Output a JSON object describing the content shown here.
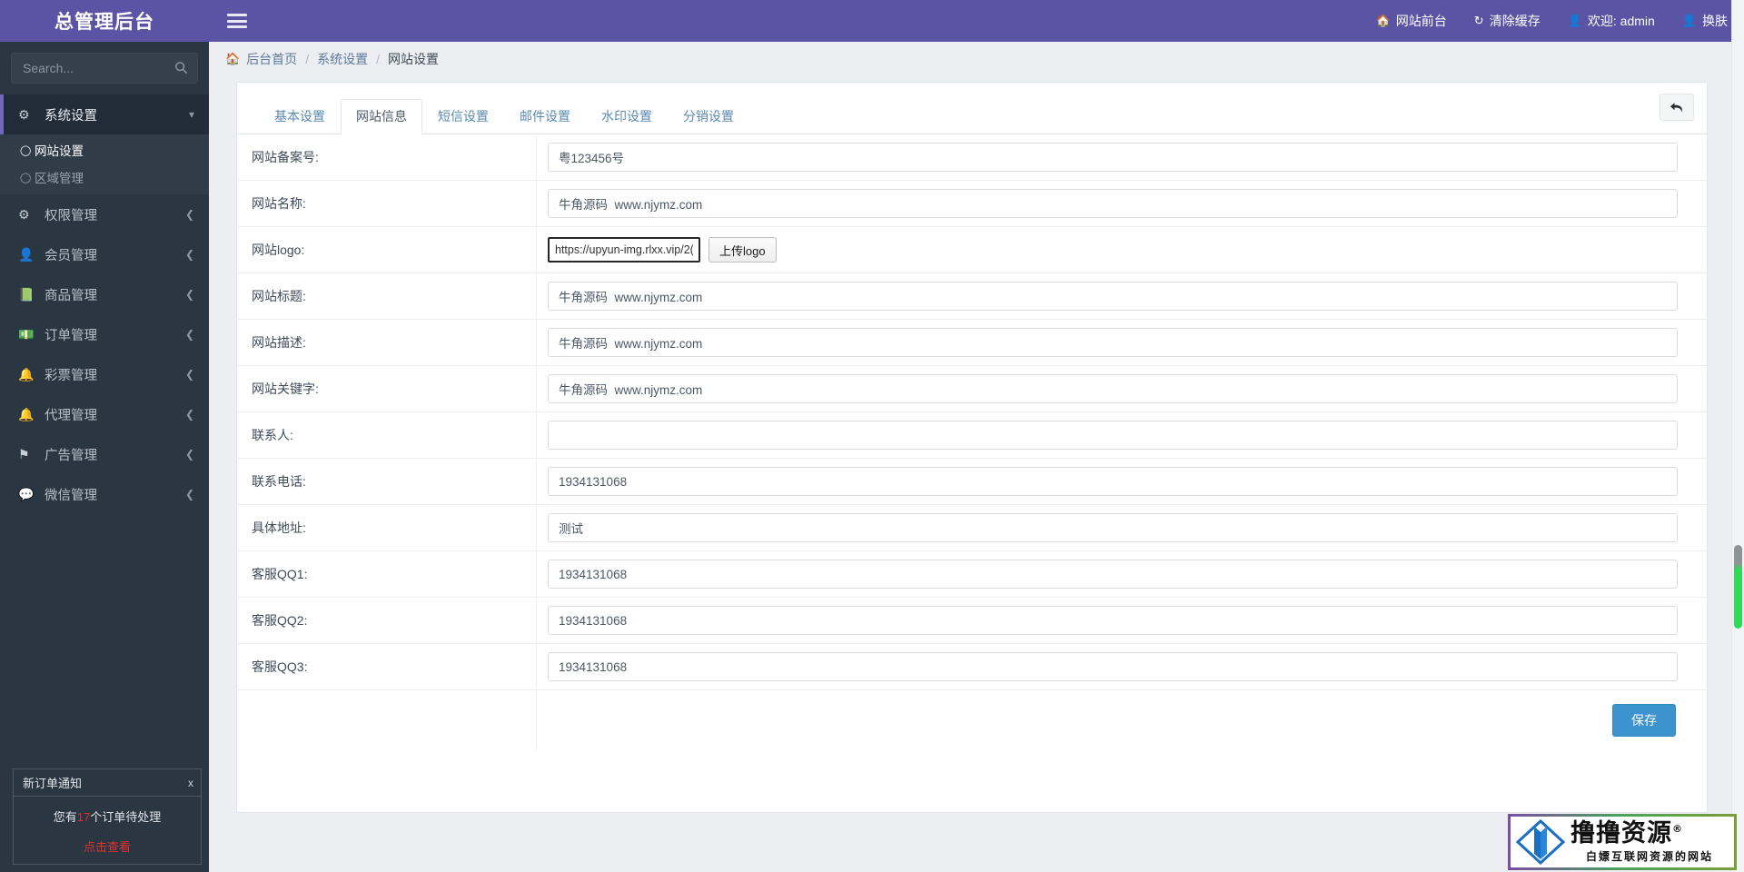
{
  "brand": {
    "title": "总管理后台"
  },
  "sidebar": {
    "search": {
      "placeholder": "Search...",
      "value": "",
      "icon": "search-icon"
    },
    "groups": [
      {
        "label": "系统设置",
        "icon": "gear-icon",
        "caret": "chevron-down-icon",
        "open": true,
        "items": [
          {
            "label": "网站设置",
            "active": true
          },
          {
            "label": "区域管理",
            "active": false
          }
        ]
      },
      {
        "label": "权限管理",
        "icon": "cogs-icon",
        "caret": "chevron-left-icon",
        "open": false,
        "items": []
      },
      {
        "label": "会员管理",
        "icon": "user-icon",
        "caret": "chevron-left-icon",
        "open": false,
        "items": []
      },
      {
        "label": "商品管理",
        "icon": "book-icon",
        "caret": "chevron-left-icon",
        "open": false,
        "items": []
      },
      {
        "label": "订单管理",
        "icon": "money-icon",
        "caret": "chevron-left-icon",
        "open": false,
        "items": []
      },
      {
        "label": "彩票管理",
        "icon": "bell-icon",
        "caret": "chevron-left-icon",
        "open": false,
        "items": []
      },
      {
        "label": "代理管理",
        "icon": "bell-icon",
        "caret": "chevron-left-icon",
        "open": false,
        "items": []
      },
      {
        "label": "广告管理",
        "icon": "flag-icon",
        "caret": "chevron-left-icon",
        "open": false,
        "items": []
      },
      {
        "label": "微信管理",
        "icon": "wechat-icon",
        "caret": "chevron-left-icon",
        "open": false,
        "items": []
      }
    ]
  },
  "notification": {
    "title": "新订单通知",
    "close_label": "x",
    "message_prefix": "您有",
    "count": "17",
    "message_suffix": "个订单待处理",
    "link_label": "点击查看",
    "accent_color": "#e03030"
  },
  "topbar": {
    "menu_toggle_icon": "hamburger-icon",
    "items": [
      {
        "label": "网站前台",
        "icon": "home-icon"
      },
      {
        "label": "清除缓存",
        "icon": "refresh-icon"
      },
      {
        "label": "欢迎: admin",
        "icon": "user-icon"
      },
      {
        "label": "换肤",
        "icon": "skin-icon"
      }
    ]
  },
  "breadcrumb": {
    "home_icon": "home-icon",
    "items": [
      "后台首页",
      "系统设置"
    ],
    "separator": "/",
    "current": "网站设置"
  },
  "panel": {
    "back_button": {
      "icon": "undo-arrow-icon",
      "label": "↰"
    },
    "tabs": [
      {
        "label": "基本设置",
        "active": false
      },
      {
        "label": "网站信息",
        "active": true
      },
      {
        "label": "短信设置",
        "active": false
      },
      {
        "label": "邮件设置",
        "active": false
      },
      {
        "label": "水印设置",
        "active": false
      },
      {
        "label": "分销设置",
        "active": false
      }
    ],
    "fields": [
      {
        "label": "网站备案号:",
        "value": "粤123456号",
        "type": "text"
      },
      {
        "label": "网站名称:",
        "value": "牛角源码  www.njymz.com",
        "type": "text"
      },
      {
        "label": "网站logo:",
        "value": "https://upyun-img.rlxx.vip/2(",
        "type": "logo",
        "button_label": "上传logo"
      },
      {
        "label": "网站标题:",
        "value": "牛角源码  www.njymz.com",
        "type": "text"
      },
      {
        "label": "网站描述:",
        "value": "牛角源码  www.njymz.com",
        "type": "text"
      },
      {
        "label": "网站关键字:",
        "value": "牛角源码  www.njymz.com",
        "type": "text"
      },
      {
        "label": "联系人:",
        "value": "",
        "type": "text"
      },
      {
        "label": "联系电话:",
        "value": "1934131068",
        "type": "text"
      },
      {
        "label": "具体地址:",
        "value": "测试",
        "type": "text"
      },
      {
        "label": "客服QQ1:",
        "value": "1934131068",
        "type": "text"
      },
      {
        "label": "客服QQ2:",
        "value": "1934131068",
        "type": "text"
      },
      {
        "label": "客服QQ3:",
        "value": "1934131068",
        "type": "text"
      }
    ],
    "save_label": "保存"
  },
  "watermark": {
    "title": "撸撸资源",
    "registered": "®",
    "subtitle": "白嫖互联网资源的网站"
  },
  "colors": {
    "brand_purple": "#5b54a4",
    "sidebar_dark": "#2b3643",
    "save_blue": "#3d93cd",
    "scrollbar_green": "#2ddc55"
  }
}
